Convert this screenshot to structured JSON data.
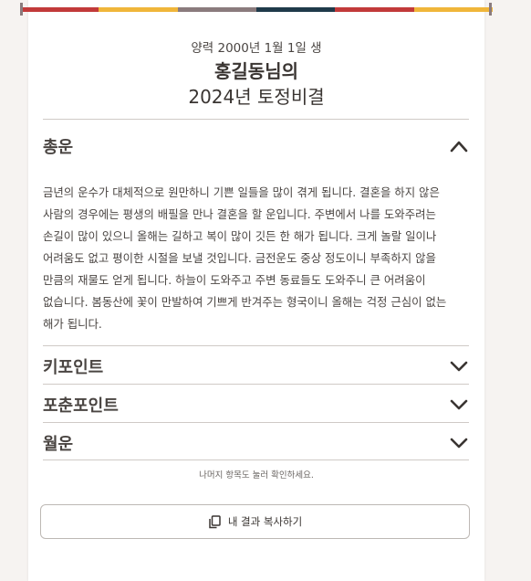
{
  "header": {
    "birth": "양력 2000년 1월 1일 생",
    "name_line": "홍길동님의",
    "year_line": "2024년 토정비결"
  },
  "colors": {
    "stripe": [
      "#c23a3a",
      "#f0b63a",
      "#8a7b7d",
      "#1f3a4a",
      "#c23a3a",
      "#f0b63a"
    ],
    "accent": "#3a3532"
  },
  "sections": {
    "general": {
      "title": "총운",
      "expanded": true,
      "icon": "chevron-up-icon",
      "text": "금년의 운수가 대체적으로 원만하니 기쁜 일들을 많이 겪게 됩니다. 결혼을 하지 않은 사람의 경우에는 평생의 배필을 만나 결혼을 할 운입니다. 주변에서 나를 도와주려는 손길이 많이 있으니 올해는 길하고 복이 많이 깃든 한 해가 됩니다. 크게 놀랄 일이나 어려움도 없고 평이한 시절을 보낼 것입니다. 금전운도 중상 정도이니 부족하지 않을 만큼의 재물도 얻게 됩니다. 하늘이 도와주고 주변 동료들도 도와주니 큰 어려움이 없습니다. 봄동산에 꽃이 만발하여 기쁘게 반겨주는 형국이니 올해는 걱정 근심이 없는 해가 됩니다."
    },
    "keypoint": {
      "title": "키포인트",
      "icon": "chevron-down-icon"
    },
    "focus": {
      "title": "포춘포인트",
      "icon": "chevron-down-icon"
    },
    "monthly": {
      "title": "월운",
      "icon": "chevron-down-icon"
    }
  },
  "hint": "나머지 항목도 눌러 확인하세요.",
  "copy_button": {
    "label": "내 결과 복사하기",
    "icon": "copy-icon"
  }
}
